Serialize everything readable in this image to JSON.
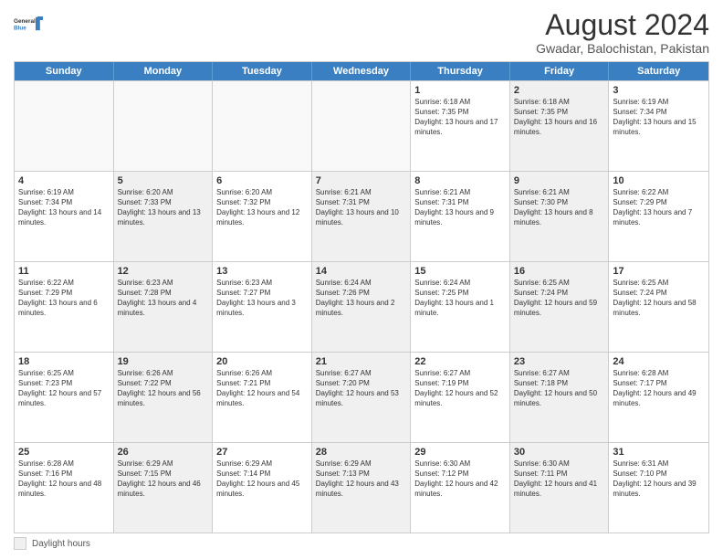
{
  "header": {
    "logo_line1": "General",
    "logo_line2": "Blue",
    "month_title": "August 2024",
    "subtitle": "Gwadar, Balochistan, Pakistan"
  },
  "days_of_week": [
    "Sunday",
    "Monday",
    "Tuesday",
    "Wednesday",
    "Thursday",
    "Friday",
    "Saturday"
  ],
  "weeks": [
    [
      {
        "day": "",
        "info": "",
        "shaded": false,
        "empty": true
      },
      {
        "day": "",
        "info": "",
        "shaded": false,
        "empty": true
      },
      {
        "day": "",
        "info": "",
        "shaded": false,
        "empty": true
      },
      {
        "day": "",
        "info": "",
        "shaded": false,
        "empty": true
      },
      {
        "day": "1",
        "info": "Sunrise: 6:18 AM\nSunset: 7:35 PM\nDaylight: 13 hours and 17 minutes.",
        "shaded": false,
        "empty": false
      },
      {
        "day": "2",
        "info": "Sunrise: 6:18 AM\nSunset: 7:35 PM\nDaylight: 13 hours and 16 minutes.",
        "shaded": true,
        "empty": false
      },
      {
        "day": "3",
        "info": "Sunrise: 6:19 AM\nSunset: 7:34 PM\nDaylight: 13 hours and 15 minutes.",
        "shaded": false,
        "empty": false
      }
    ],
    [
      {
        "day": "4",
        "info": "Sunrise: 6:19 AM\nSunset: 7:34 PM\nDaylight: 13 hours and 14 minutes.",
        "shaded": false,
        "empty": false
      },
      {
        "day": "5",
        "info": "Sunrise: 6:20 AM\nSunset: 7:33 PM\nDaylight: 13 hours and 13 minutes.",
        "shaded": true,
        "empty": false
      },
      {
        "day": "6",
        "info": "Sunrise: 6:20 AM\nSunset: 7:32 PM\nDaylight: 13 hours and 12 minutes.",
        "shaded": false,
        "empty": false
      },
      {
        "day": "7",
        "info": "Sunrise: 6:21 AM\nSunset: 7:31 PM\nDaylight: 13 hours and 10 minutes.",
        "shaded": true,
        "empty": false
      },
      {
        "day": "8",
        "info": "Sunrise: 6:21 AM\nSunset: 7:31 PM\nDaylight: 13 hours and 9 minutes.",
        "shaded": false,
        "empty": false
      },
      {
        "day": "9",
        "info": "Sunrise: 6:21 AM\nSunset: 7:30 PM\nDaylight: 13 hours and 8 minutes.",
        "shaded": true,
        "empty": false
      },
      {
        "day": "10",
        "info": "Sunrise: 6:22 AM\nSunset: 7:29 PM\nDaylight: 13 hours and 7 minutes.",
        "shaded": false,
        "empty": false
      }
    ],
    [
      {
        "day": "11",
        "info": "Sunrise: 6:22 AM\nSunset: 7:29 PM\nDaylight: 13 hours and 6 minutes.",
        "shaded": false,
        "empty": false
      },
      {
        "day": "12",
        "info": "Sunrise: 6:23 AM\nSunset: 7:28 PM\nDaylight: 13 hours and 4 minutes.",
        "shaded": true,
        "empty": false
      },
      {
        "day": "13",
        "info": "Sunrise: 6:23 AM\nSunset: 7:27 PM\nDaylight: 13 hours and 3 minutes.",
        "shaded": false,
        "empty": false
      },
      {
        "day": "14",
        "info": "Sunrise: 6:24 AM\nSunset: 7:26 PM\nDaylight: 13 hours and 2 minutes.",
        "shaded": true,
        "empty": false
      },
      {
        "day": "15",
        "info": "Sunrise: 6:24 AM\nSunset: 7:25 PM\nDaylight: 13 hours and 1 minute.",
        "shaded": false,
        "empty": false
      },
      {
        "day": "16",
        "info": "Sunrise: 6:25 AM\nSunset: 7:24 PM\nDaylight: 12 hours and 59 minutes.",
        "shaded": true,
        "empty": false
      },
      {
        "day": "17",
        "info": "Sunrise: 6:25 AM\nSunset: 7:24 PM\nDaylight: 12 hours and 58 minutes.",
        "shaded": false,
        "empty": false
      }
    ],
    [
      {
        "day": "18",
        "info": "Sunrise: 6:25 AM\nSunset: 7:23 PM\nDaylight: 12 hours and 57 minutes.",
        "shaded": false,
        "empty": false
      },
      {
        "day": "19",
        "info": "Sunrise: 6:26 AM\nSunset: 7:22 PM\nDaylight: 12 hours and 56 minutes.",
        "shaded": true,
        "empty": false
      },
      {
        "day": "20",
        "info": "Sunrise: 6:26 AM\nSunset: 7:21 PM\nDaylight: 12 hours and 54 minutes.",
        "shaded": false,
        "empty": false
      },
      {
        "day": "21",
        "info": "Sunrise: 6:27 AM\nSunset: 7:20 PM\nDaylight: 12 hours and 53 minutes.",
        "shaded": true,
        "empty": false
      },
      {
        "day": "22",
        "info": "Sunrise: 6:27 AM\nSunset: 7:19 PM\nDaylight: 12 hours and 52 minutes.",
        "shaded": false,
        "empty": false
      },
      {
        "day": "23",
        "info": "Sunrise: 6:27 AM\nSunset: 7:18 PM\nDaylight: 12 hours and 50 minutes.",
        "shaded": true,
        "empty": false
      },
      {
        "day": "24",
        "info": "Sunrise: 6:28 AM\nSunset: 7:17 PM\nDaylight: 12 hours and 49 minutes.",
        "shaded": false,
        "empty": false
      }
    ],
    [
      {
        "day": "25",
        "info": "Sunrise: 6:28 AM\nSunset: 7:16 PM\nDaylight: 12 hours and 48 minutes.",
        "shaded": false,
        "empty": false
      },
      {
        "day": "26",
        "info": "Sunrise: 6:29 AM\nSunset: 7:15 PM\nDaylight: 12 hours and 46 minutes.",
        "shaded": true,
        "empty": false
      },
      {
        "day": "27",
        "info": "Sunrise: 6:29 AM\nSunset: 7:14 PM\nDaylight: 12 hours and 45 minutes.",
        "shaded": false,
        "empty": false
      },
      {
        "day": "28",
        "info": "Sunrise: 6:29 AM\nSunset: 7:13 PM\nDaylight: 12 hours and 43 minutes.",
        "shaded": true,
        "empty": false
      },
      {
        "day": "29",
        "info": "Sunrise: 6:30 AM\nSunset: 7:12 PM\nDaylight: 12 hours and 42 minutes.",
        "shaded": false,
        "empty": false
      },
      {
        "day": "30",
        "info": "Sunrise: 6:30 AM\nSunset: 7:11 PM\nDaylight: 12 hours and 41 minutes.",
        "shaded": true,
        "empty": false
      },
      {
        "day": "31",
        "info": "Sunrise: 6:31 AM\nSunset: 7:10 PM\nDaylight: 12 hours and 39 minutes.",
        "shaded": false,
        "empty": false
      }
    ]
  ],
  "legend": {
    "label": "Daylight hours"
  }
}
